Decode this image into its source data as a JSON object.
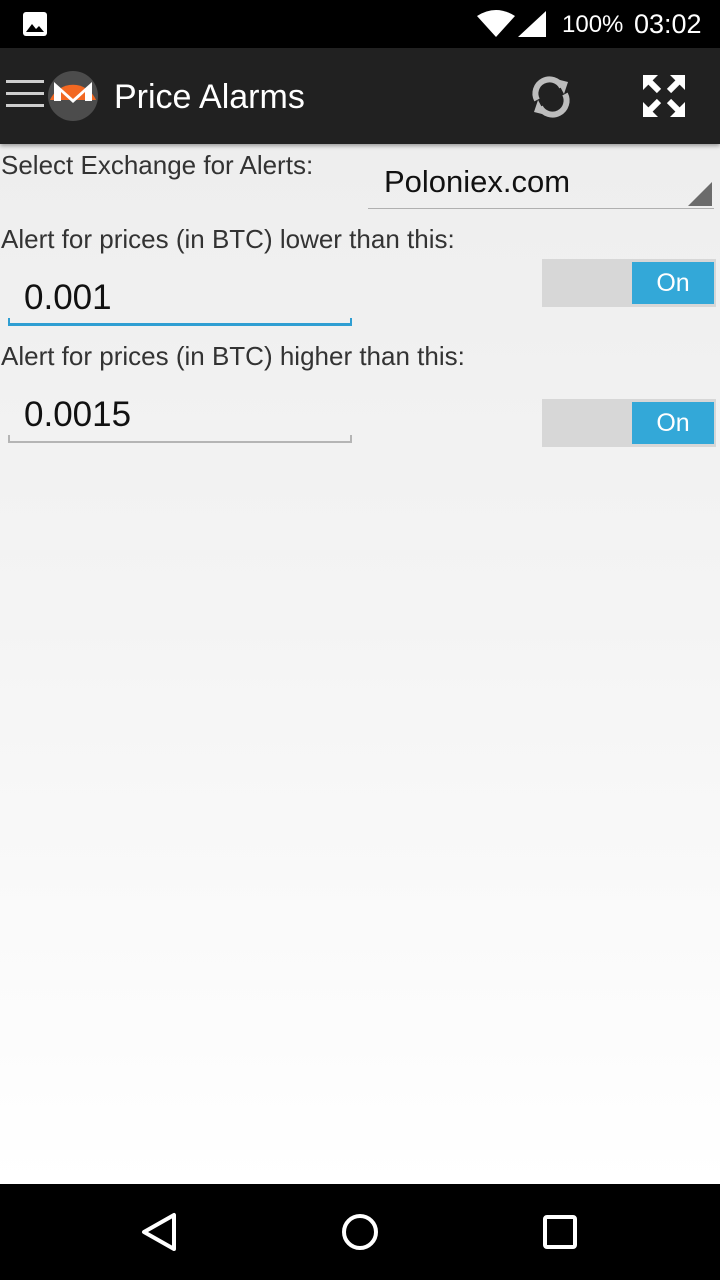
{
  "status_bar": {
    "battery": "100%",
    "time": "03:02",
    "icons": [
      "gallery-icon",
      "wifi-icon",
      "signal-icon"
    ]
  },
  "action_bar": {
    "title": "Price Alarms",
    "icons": [
      "hamburger-menu-icon",
      "monero-logo-icon",
      "refresh-icon",
      "fullscreen-icon"
    ]
  },
  "form": {
    "exchange_label": "Select Exchange for Alerts:",
    "exchange_value": "Poloniex.com",
    "lower_label": "Alert for prices (in BTC) lower than this:",
    "lower_value": "0.001",
    "lower_toggle": "On",
    "higher_label": "Alert for prices (in BTC) higher than this:",
    "higher_value": "0.0015",
    "higher_toggle": "On"
  },
  "colors": {
    "accent": "#33a8d8",
    "action_bar": "#212121",
    "logo_orange": "#f26822"
  },
  "nav_bar": {
    "icons": [
      "back-icon",
      "home-icon",
      "recents-icon"
    ]
  }
}
